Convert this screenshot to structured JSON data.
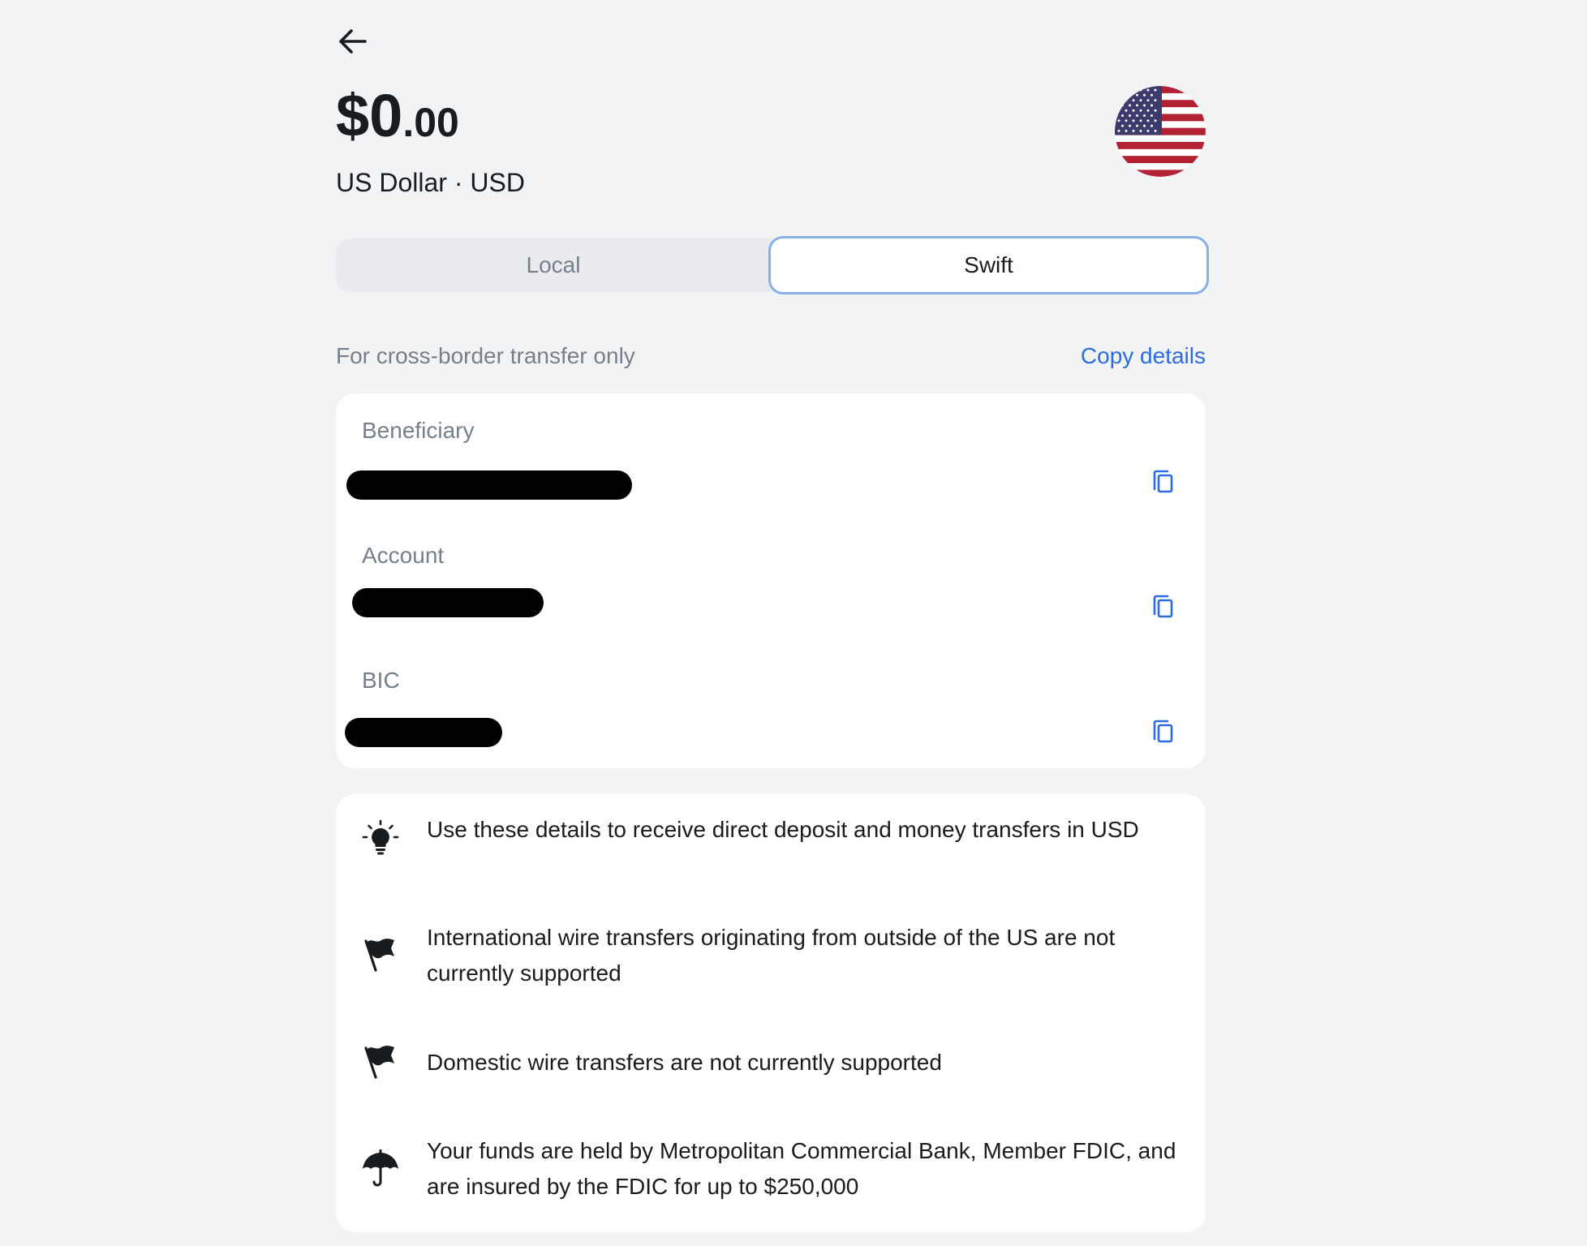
{
  "balance": {
    "integer": "$0",
    "decimal": ".00"
  },
  "currency": {
    "label": "US Dollar · USD",
    "flag": "us-flag-icon"
  },
  "tabs": {
    "local": "Local",
    "swift": "Swift",
    "active": "Swift"
  },
  "note": "For cross-border transfer only",
  "copy_details": "Copy details",
  "fields": [
    {
      "label": "Beneficiary"
    },
    {
      "label": "Account"
    },
    {
      "label": "BIC"
    }
  ],
  "info": [
    {
      "icon": "lightbulb-icon",
      "text": "Use these details to receive direct deposit and money transfers in USD"
    },
    {
      "icon": "flag-icon",
      "text": "International wire transfers originating from outside of the US are not currently supported"
    },
    {
      "icon": "flag-icon",
      "text": "Domestic wire transfers are not currently supported"
    },
    {
      "icon": "umbrella-icon",
      "text": "Your funds are held by Metropolitan Commercial Bank, Member FDIC, and are insured by the FDIC for up to $250,000"
    }
  ],
  "colors": {
    "accent": "#2b6de0",
    "tab_border": "#8ab0ea",
    "background": "#f2f3f5",
    "muted_text": "#75808a"
  }
}
